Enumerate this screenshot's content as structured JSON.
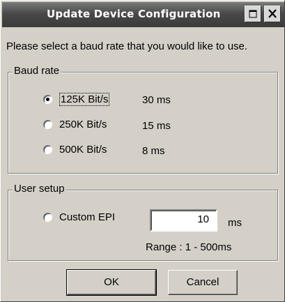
{
  "window": {
    "title": "Update Device Configuration",
    "prompt": "Please select a baud rate that you would like to use."
  },
  "baud_rate": {
    "legend": "Baud rate",
    "options": [
      {
        "label": "125K Bit/s",
        "time": "30 ms",
        "selected": true
      },
      {
        "label": "250K Bit/s",
        "time": "15 ms",
        "selected": false
      },
      {
        "label": "500K Bit/s",
        "time": "8 ms",
        "selected": false
      }
    ]
  },
  "user_setup": {
    "legend": "User setup",
    "custom_label": "Custom EPI",
    "custom_selected": false,
    "value": "10",
    "unit": "ms",
    "range": "Range : 1 - 500ms"
  },
  "buttons": {
    "ok": "OK",
    "cancel": "Cancel"
  },
  "icons": {
    "restore": "restore-icon",
    "close": "close-icon"
  }
}
